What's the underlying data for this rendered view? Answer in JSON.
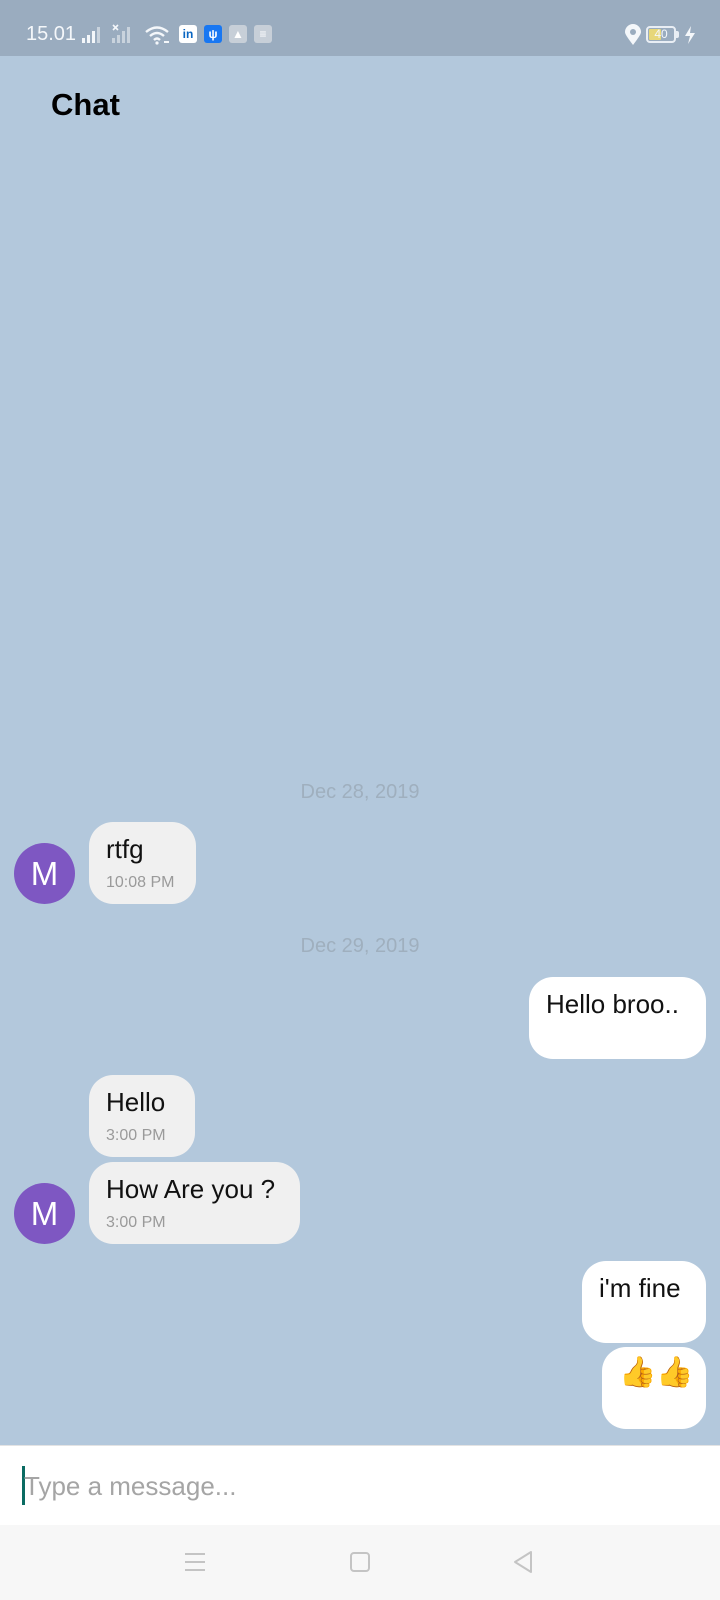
{
  "status_bar": {
    "time": "15.01",
    "battery": "40",
    "icons": [
      "signal-icon",
      "signal-no-service-icon",
      "wifi-icon",
      "linkedin-icon",
      "usb-icon",
      "drive-icon",
      "layers-icon",
      "location-icon",
      "battery-icon",
      "charging-icon"
    ]
  },
  "header": {
    "title": "Chat"
  },
  "messages": {
    "date1": "Dec 28, 2019",
    "m1": {
      "sender": "M",
      "text": "rtfg",
      "time": "10:08 PM"
    },
    "date2": "Dec 29, 2019",
    "m2": {
      "text": "Hello broo.."
    },
    "m3": {
      "text": "Hello",
      "time": "3:00 PM"
    },
    "m4": {
      "sender": "M",
      "text": "How Are you ?",
      "time": "3:00 PM"
    },
    "m5": {
      "text": "i'm fine"
    },
    "m6": {
      "text": "👍👍"
    }
  },
  "composer": {
    "placeholder": "Type a message...",
    "value": ""
  },
  "nav": {
    "icons": [
      "menu-icon",
      "home-icon",
      "back-icon"
    ]
  },
  "colors": {
    "background": "#b3c8dc",
    "status_bar": "#9aacbf",
    "avatar": "#7e57c2",
    "incoming_bubble": "#f0f0f0",
    "outgoing_bubble": "#ffffff",
    "caret": "#0a6b62"
  }
}
